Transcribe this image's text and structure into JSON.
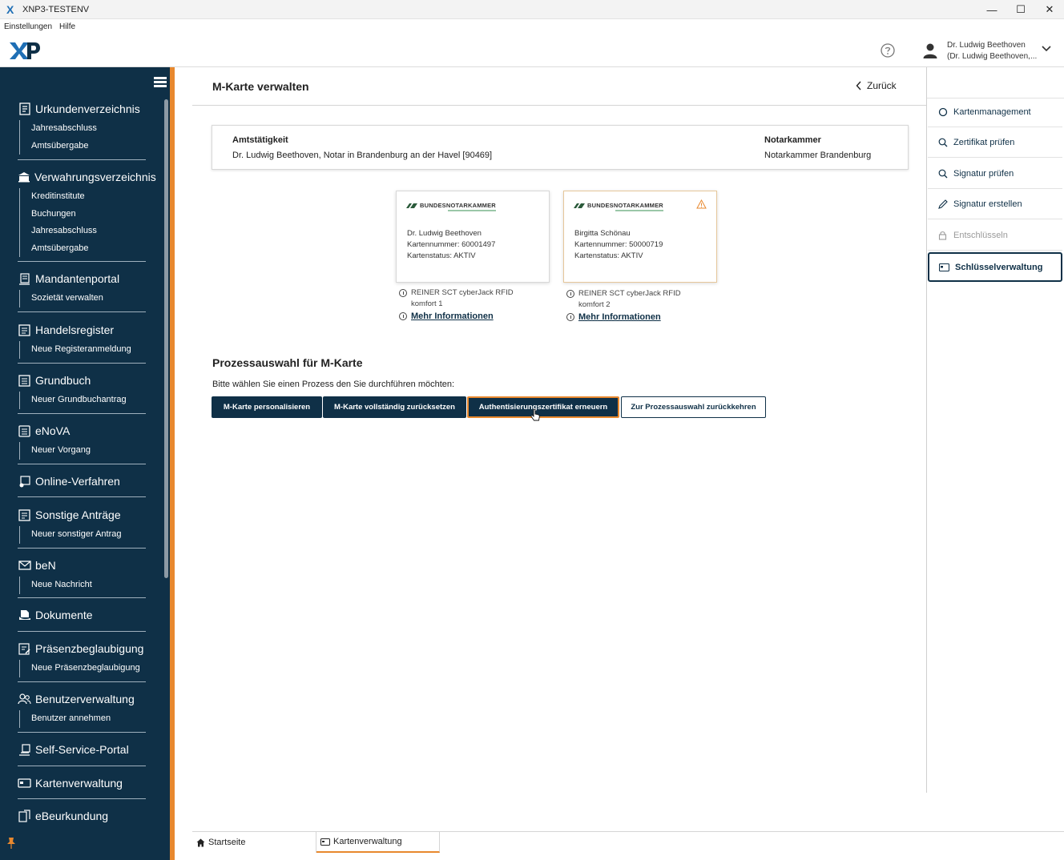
{
  "window": {
    "title": "XNP3-TESTENV",
    "minimize": "—",
    "maximize": "☐",
    "close": "✕"
  },
  "menu": {
    "items": [
      "Einstellungen",
      "Hilfe"
    ]
  },
  "header": {
    "user_line1": "Dr. Ludwig Beethoven",
    "user_line2": "(Dr. Ludwig Beethoven,..."
  },
  "sidebar": {
    "sections": [
      {
        "label": "Urkundenverzeichnis",
        "icon": "document-list-icon",
        "subs": [
          "Jahresabschluss",
          "Amtsübergabe"
        ]
      },
      {
        "label": "Verwahrungsverzeichnis",
        "icon": "bank-icon",
        "subs": [
          "Kreditinstitute",
          "Buchungen",
          "Jahresabschluss",
          "Amtsübergabe"
        ]
      },
      {
        "label": "Mandantenportal",
        "icon": "portal-icon",
        "subs": [
          "Sozietät verwalten"
        ]
      },
      {
        "label": "Handelsregister",
        "icon": "register-icon",
        "subs": [
          "Neue Registeranmeldung"
        ]
      },
      {
        "label": "Grundbuch",
        "icon": "land-register-icon",
        "subs": [
          "Neuer Grundbuchantrag"
        ]
      },
      {
        "label": "eNoVA",
        "icon": "enova-icon",
        "subs": [
          "Neuer Vorgang"
        ]
      },
      {
        "label": "Online-Verfahren",
        "icon": "online-procedure-icon",
        "subs": []
      },
      {
        "label": "Sonstige Anträge",
        "icon": "other-applications-icon",
        "subs": [
          "Neuer sonstiger Antrag"
        ]
      },
      {
        "label": "beN",
        "icon": "mail-icon",
        "subs": [
          "Neue Nachricht"
        ]
      },
      {
        "label": "Dokumente",
        "icon": "documents-icon",
        "subs": []
      },
      {
        "label": "Präsenzbeglaubigung",
        "icon": "certification-icon",
        "subs": [
          "Neue Präsenzbeglaubigung"
        ]
      },
      {
        "label": "Benutzerverwaltung",
        "icon": "users-icon",
        "subs": [
          "Benutzer annehmen"
        ]
      },
      {
        "label": "Self-Service-Portal",
        "icon": "self-service-icon",
        "subs": []
      },
      {
        "label": "Kartenverwaltung",
        "icon": "card-management-icon",
        "subs": []
      },
      {
        "label": "eBeurkundung",
        "icon": "e-notarization-icon",
        "subs": []
      }
    ]
  },
  "main": {
    "title": "M-Karte verwalten",
    "back_label": "Zurück",
    "info": {
      "office_label": "Amtstätigkeit",
      "office_value": "Dr. Ludwig Beethoven, Notar in Brandenburg an der Havel [90469]",
      "chamber_label": "Notarkammer",
      "chamber_value": "Notarkammer Brandenburg"
    },
    "cards": [
      {
        "brand": "BUNDESNOTARKAMMER",
        "holder": "Dr. Ludwig Beethoven",
        "number": "Kartennummer: 60001497",
        "status": "Kartenstatus: AKTIV",
        "reader1": "REINER SCT cyberJack RFID",
        "reader2": "komfort 1",
        "more": "Mehr Informationen"
      },
      {
        "brand": "BUNDESNOTARKAMMER",
        "holder": "Birgitta Schönau",
        "number": "Kartennummer: 50000719",
        "status": "Kartenstatus: AKTIV",
        "reader1": "REINER SCT cyberJack RFID",
        "reader2": "komfort 2",
        "more": "Mehr Informationen"
      }
    ],
    "process_title": "Prozessauswahl für M-Karte",
    "process_subtitle": "Bitte wählen Sie einen Prozess den Sie durchführen möchten:",
    "buttons": {
      "personalize": "M-Karte personalisieren",
      "reset": "M-Karte vollständig zurücksetzen",
      "renew": "Authentisierungszertifikat erneuern",
      "return": "Zur Prozessauswahl zurückkehren"
    }
  },
  "right_panel": {
    "items": [
      {
        "label": "Kartenmanagement",
        "icon": "circle-icon",
        "state": "normal"
      },
      {
        "label": "Zertifikat prüfen",
        "icon": "search-icon",
        "state": "normal"
      },
      {
        "label": "Signatur prüfen",
        "icon": "search-icon",
        "state": "normal"
      },
      {
        "label": "Signatur erstellen",
        "icon": "pen-icon",
        "state": "normal"
      },
      {
        "label": "Entschlüsseln",
        "icon": "lock-icon",
        "state": "disabled"
      },
      {
        "label": "Schlüsselverwaltung",
        "icon": "card-icon",
        "state": "selected"
      }
    ]
  },
  "tabs": [
    {
      "label": "Startseite",
      "icon": "home-icon"
    },
    {
      "label": "Kartenverwaltung",
      "icon": "card-icon"
    }
  ],
  "colors": {
    "navy": "#0f3047",
    "accent": "#e8882e"
  }
}
